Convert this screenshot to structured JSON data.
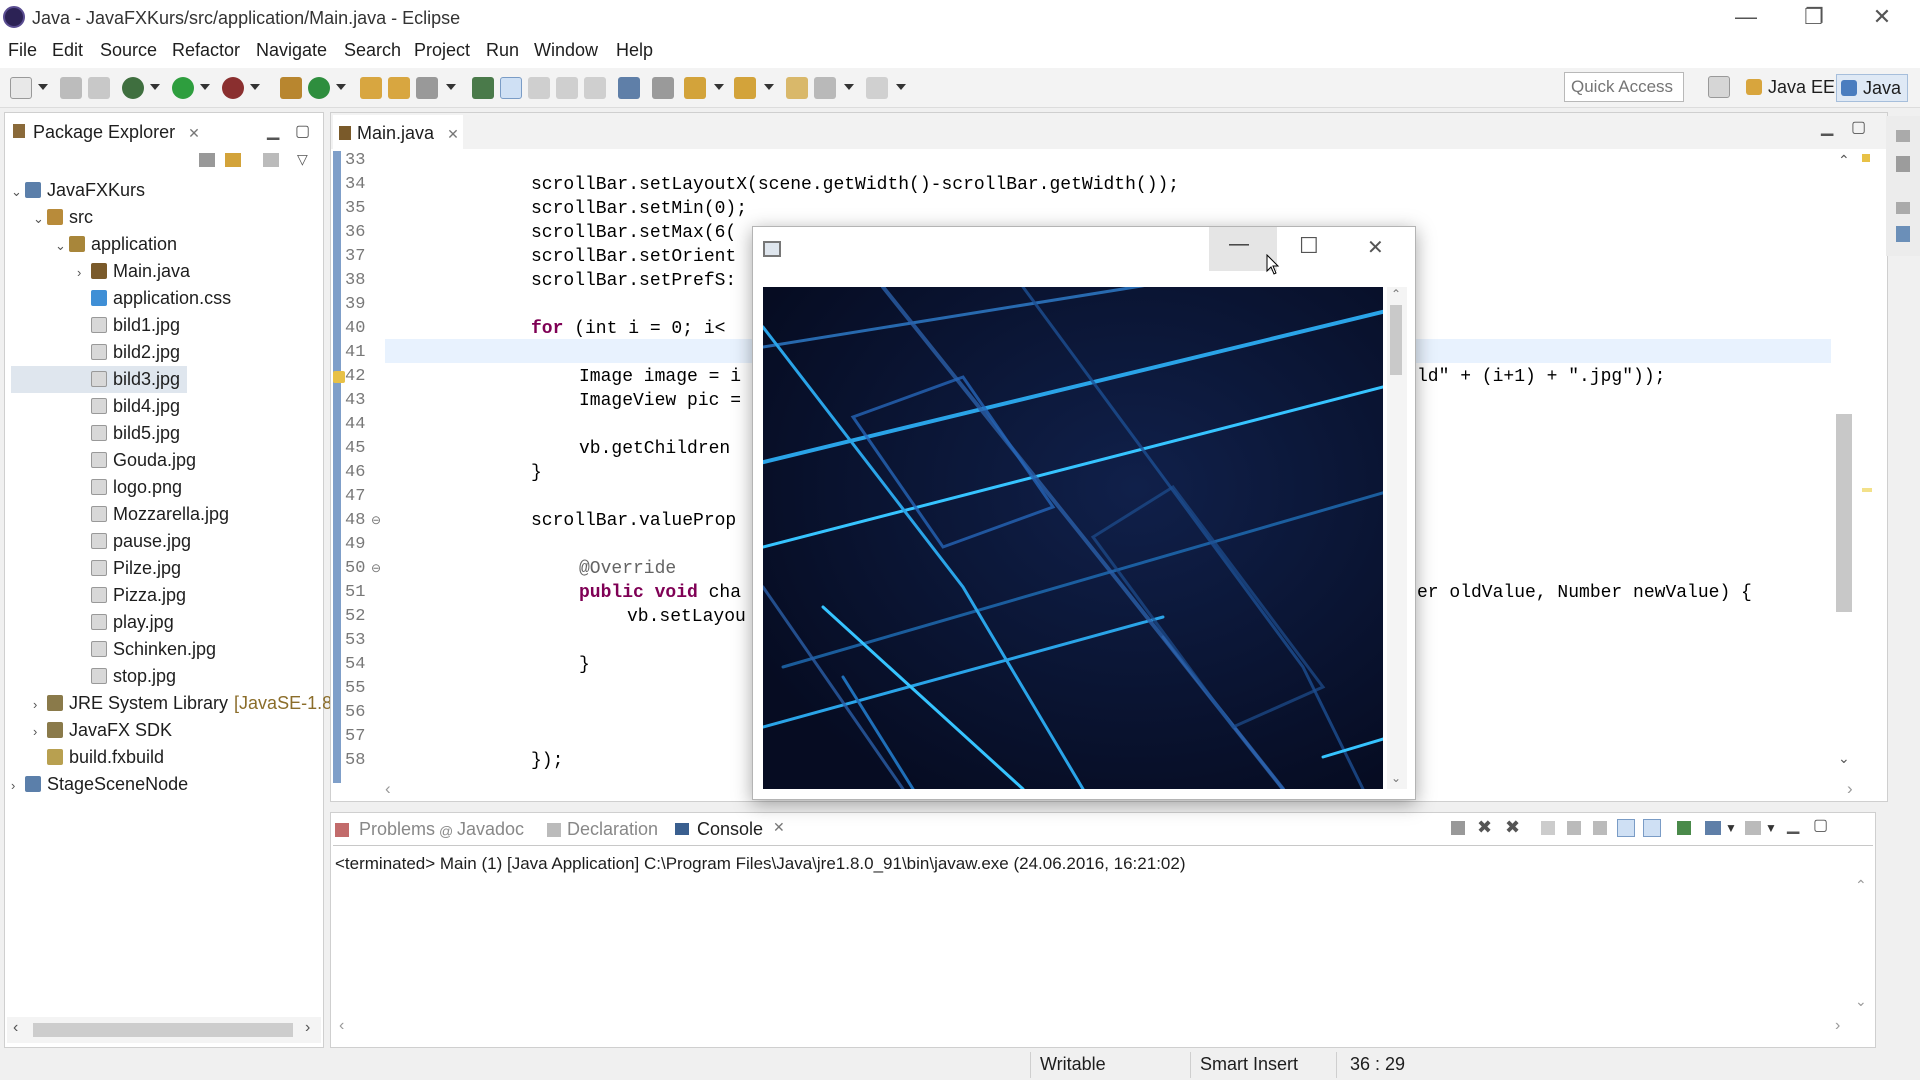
{
  "window": {
    "title": "Java - JavaFXKurs/src/application/Main.java - Eclipse",
    "minimize_glyph": "—",
    "restore_glyph": "❐",
    "close_glyph": "✕"
  },
  "menu": [
    "File",
    "Edit",
    "Source",
    "Refactor",
    "Navigate",
    "Search",
    "Project",
    "Run",
    "Window",
    "Help"
  ],
  "toolbar": {
    "quick_access_placeholder": "Quick Access",
    "perspectives": [
      "Java EE",
      "Java"
    ]
  },
  "package_explorer": {
    "tab_label": "Package Explorer",
    "tree": [
      {
        "label": "JavaFXKurs",
        "arrow": "⌄",
        "icon": "project-icon"
      },
      {
        "label": "src",
        "arrow": "⌄",
        "icon": "source-folder-icon"
      },
      {
        "label": "application",
        "arrow": "⌄",
        "icon": "package-icon"
      },
      {
        "label": "Main.java",
        "arrow": "›",
        "icon": "java-file-icon"
      },
      {
        "label": "application.css",
        "arrow": "",
        "icon": "css-file-icon"
      },
      {
        "label": "bild1.jpg",
        "arrow": "",
        "icon": "file-icon"
      },
      {
        "label": "bild2.jpg",
        "arrow": "",
        "icon": "file-icon"
      },
      {
        "label": "bild3.jpg",
        "arrow": "",
        "icon": "file-icon"
      },
      {
        "label": "bild4.jpg",
        "arrow": "",
        "icon": "file-icon"
      },
      {
        "label": "bild5.jpg",
        "arrow": "",
        "icon": "file-icon"
      },
      {
        "label": "Gouda.jpg",
        "arrow": "",
        "icon": "file-icon"
      },
      {
        "label": "logo.png",
        "arrow": "",
        "icon": "file-icon"
      },
      {
        "label": "Mozzarella.jpg",
        "arrow": "",
        "icon": "file-icon"
      },
      {
        "label": "pause.jpg",
        "arrow": "",
        "icon": "file-icon"
      },
      {
        "label": "Pilze.jpg",
        "arrow": "",
        "icon": "file-icon"
      },
      {
        "label": "Pizza.jpg",
        "arrow": "",
        "icon": "file-icon"
      },
      {
        "label": "play.jpg",
        "arrow": "",
        "icon": "file-icon"
      },
      {
        "label": "Schinken.jpg",
        "arrow": "",
        "icon": "file-icon"
      },
      {
        "label": "stop.jpg",
        "arrow": "",
        "icon": "file-icon"
      },
      {
        "label": "JRE System Library",
        "extra": "[JavaSE-1.8",
        "arrow": "›",
        "icon": "library-icon"
      },
      {
        "label": "JavaFX SDK",
        "arrow": "›",
        "icon": "library-icon"
      },
      {
        "label": "build.fxbuild",
        "arrow": "",
        "icon": "fxbuild-icon"
      },
      {
        "label": "StageSceneNode",
        "arrow": "›",
        "icon": "project-icon"
      }
    ],
    "selected": "bild3.jpg"
  },
  "editor": {
    "tab_label": "Main.java",
    "line_numbers": [
      "33",
      "34",
      "35",
      "36",
      "37",
      "38",
      "39",
      "40",
      "41",
      "42",
      "43",
      "44",
      "45",
      "46",
      "47",
      "48",
      "49",
      "50",
      "51",
      "52",
      "53",
      "54",
      "55",
      "56",
      "57",
      "58"
    ],
    "lines": {
      "l34": "scrollBar.setLayoutX(scene.getWidth()-scrollBar.getWidth());",
      "l35": "scrollBar.setMin(0);",
      "l36": "scrollBar.setMax(6(",
      "l37": "scrollBar.setOrient",
      "l38": "scrollBar.setPrefS:",
      "l40_kw": "for",
      "l40_rest": " (int i = 0; i<",
      "l42": "Image image = i",
      "l42_tail": "ld\" + (i+1) + \".jpg\"));",
      "l43": "ImageView pic =",
      "l45": "vb.getChildren",
      "l46": "}",
      "l48": "scrollBar.valueProp",
      "l50": "@Override",
      "l51_kw": "public void",
      "l51_rest": " cha",
      "l51_tail": "er oldValue, Number newValue) {",
      "l52": "vb.setLayou",
      "l54": "}",
      "l58": "});"
    }
  },
  "console": {
    "tabs": [
      "Problems",
      "Javadoc",
      "Declaration",
      "Console"
    ],
    "active_tab": "Console",
    "status_line": "<terminated> Main (1) [Java Application] C:\\Program Files\\Java\\jre1.8.0_91\\bin\\javaw.exe (24.06.2016, 16:21:02)"
  },
  "statusbar": {
    "writable": "Writable",
    "insert_mode": "Smart Insert",
    "position": "36 : 29"
  },
  "popup": {
    "minimize_glyph": "—",
    "maximize_glyph": "☐",
    "close_glyph": "✕"
  },
  "colors": {
    "keyword": "#7f0055",
    "field": "#0000c0",
    "string": "#2a00ff",
    "image_bg": "#0b1633",
    "image_line": "#2aa4e8"
  }
}
